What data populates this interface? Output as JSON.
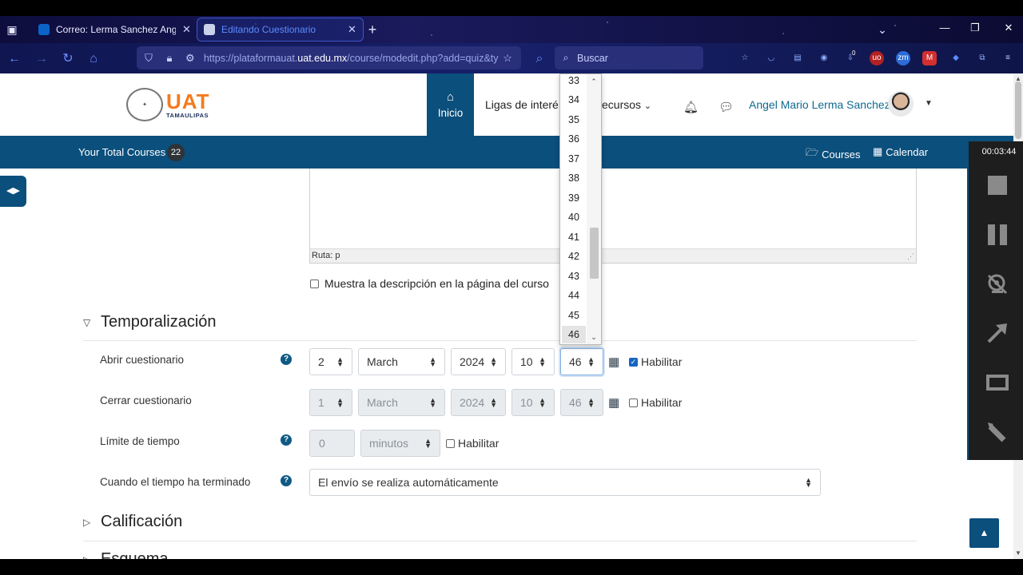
{
  "browser": {
    "tabs": [
      {
        "label": "Correo: Lerma Sanchez Angel M..."
      },
      {
        "label": "Editando Cuestionario"
      }
    ],
    "url_prefix": "https://plataformauat.",
    "url_domain": "uat.edu.mx",
    "url_path": "/course/modedit.php?add=quiz&ty",
    "search_placeholder": "Buscar",
    "ext_badge": "0"
  },
  "header": {
    "logo_text": "UAT",
    "logo_sub": "TAMAULIPAS",
    "nav_home": "Inicio",
    "nav_links": "Ligas de interé",
    "nav_resources": "ecursos",
    "user_name": "Angel Mario Lerma Sanchez"
  },
  "subnav": {
    "total_courses_label": "Your Total Courses",
    "total_courses_count": "22",
    "courses": "Courses",
    "calendar": "Calendar"
  },
  "editor": {
    "path": "Ruta: p"
  },
  "show_description": "Muestra la descripción en la página del curso",
  "sections": {
    "timing": "Temporalización",
    "grade": "Calificación",
    "layout": "Esquema"
  },
  "open_quiz": {
    "label": "Abrir cuestionario",
    "day": "2",
    "month": "March",
    "year": "2024",
    "hour": "10",
    "minute": "46",
    "enable": "Habilitar",
    "enabled": true
  },
  "close_quiz": {
    "label": "Cerrar cuestionario",
    "day": "1",
    "month": "March",
    "year": "2024",
    "hour": "10",
    "minute": "46",
    "enable": "Habilitar",
    "enabled": false
  },
  "time_limit": {
    "label": "Límite de tiempo",
    "value": "0",
    "unit": "minutos",
    "enable": "Habilitar"
  },
  "when_time_expires": {
    "label": "Cuando el tiempo ha terminado",
    "value": "El envío se realiza automáticamente"
  },
  "minute_dropdown": {
    "options": [
      "33",
      "34",
      "35",
      "36",
      "37",
      "38",
      "39",
      "40",
      "41",
      "42",
      "43",
      "44",
      "45",
      "46"
    ],
    "selected": "46"
  },
  "recorder": {
    "time": "00:03:44"
  },
  "colors": {
    "brand_blue": "#0b4f7c",
    "uat_orange": "#f47b20",
    "link": "#0f6a8f"
  }
}
